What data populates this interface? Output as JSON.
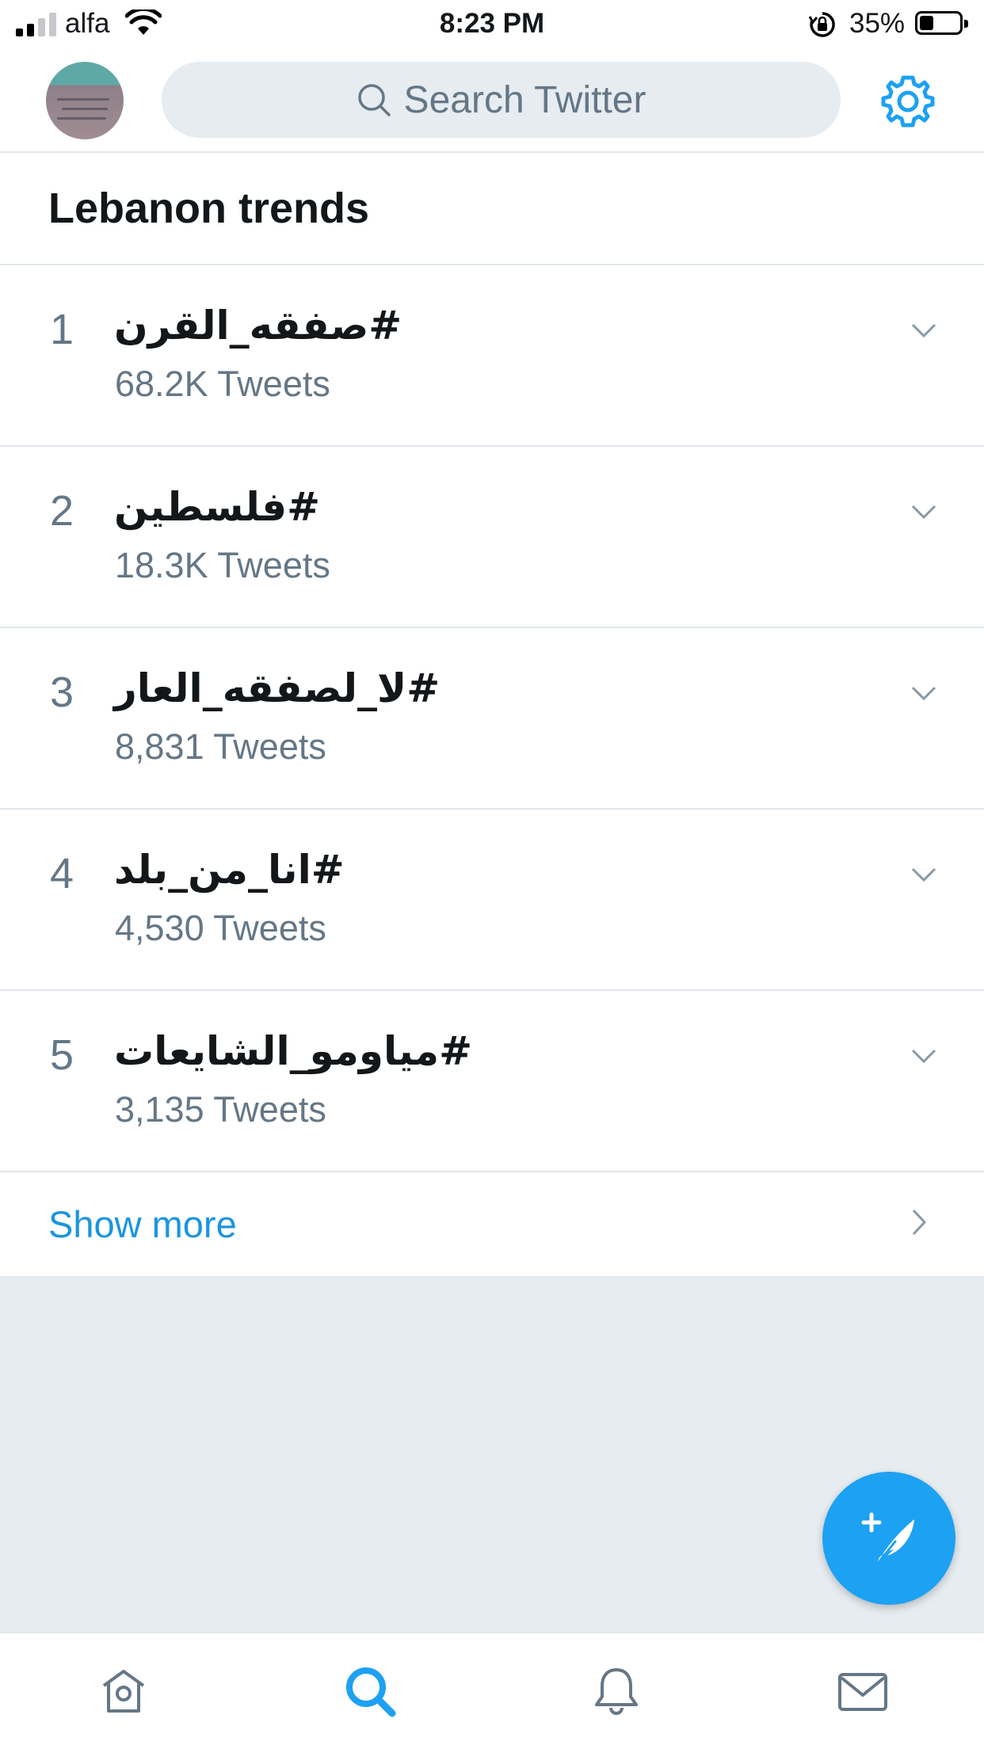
{
  "status_bar": {
    "carrier": "alfa",
    "time": "8:23 PM",
    "battery_percent": "35%",
    "signal_bars": 2,
    "battery_level": 0.35,
    "icons": [
      "signal-icon",
      "wifi-icon",
      "rotation-lock-icon",
      "battery-icon"
    ]
  },
  "top_bar": {
    "search_placeholder": "Search Twitter",
    "icons": [
      "avatar",
      "search-icon",
      "gear-icon"
    ]
  },
  "trends": {
    "title": "Lebanon trends",
    "items": [
      {
        "rank": "1",
        "name": "#صفقه_القرن",
        "count": "68.2K Tweets"
      },
      {
        "rank": "2",
        "name": "#فلسطين",
        "count": "18.3K Tweets"
      },
      {
        "rank": "3",
        "name": "#لا_لصفقه_العار",
        "count": "8,831 Tweets"
      },
      {
        "rank": "4",
        "name": "#انا_من_بلد",
        "count": "4,530 Tweets"
      },
      {
        "rank": "5",
        "name": "#مياومو_الشايعات",
        "count": "3,135 Tweets"
      }
    ],
    "show_more": "Show more"
  },
  "tab_bar": {
    "tabs": [
      "home-icon",
      "search-icon",
      "notifications-icon",
      "messages-icon"
    ],
    "active": "search-icon"
  },
  "colors": {
    "accent": "#1da1f2",
    "link": "#1b95e0",
    "secondary_text": "#657786",
    "background": "#e6ecf0"
  }
}
